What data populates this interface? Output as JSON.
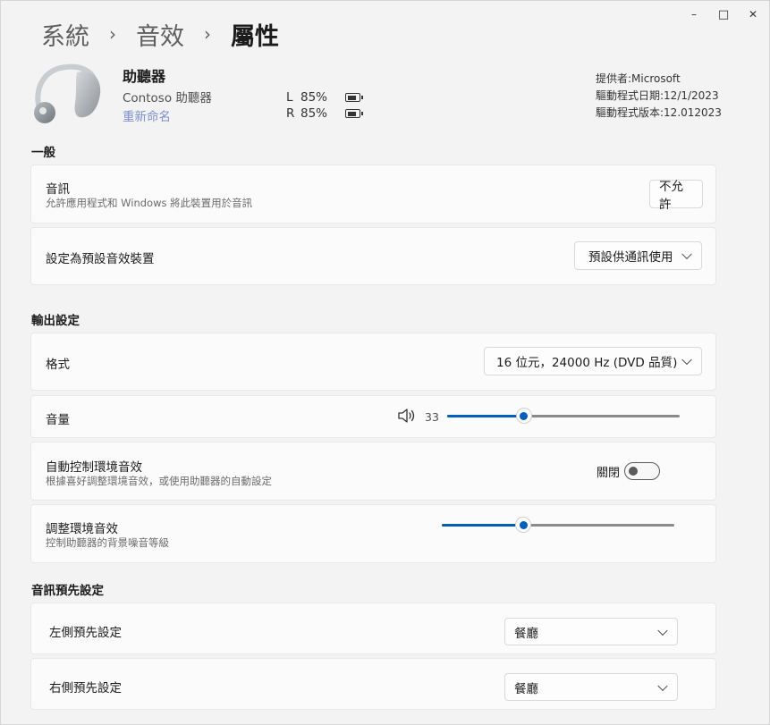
{
  "window": {
    "minimize": "–",
    "maximize": "□",
    "close": "✕"
  },
  "breadcrumb": {
    "items": [
      "系統",
      "音效"
    ],
    "separator": "›",
    "current": "屬性"
  },
  "device": {
    "name": "助聽器",
    "model": "Contoso 助聽器",
    "rename": "重新命名",
    "battery": [
      {
        "side": "L",
        "percent": "85%"
      },
      {
        "side": "R",
        "percent": "85%"
      }
    ],
    "provider": "提供者:Microsoft",
    "driver_date": "驅動程式日期:12/1/2023",
    "driver_version": "驅動程式版本:12.012023"
  },
  "general": {
    "title": "一般",
    "audio": {
      "title": "音訊",
      "subtitle": "允許應用程式和 Windows 將此裝置用於音訊",
      "button": "不允許"
    },
    "default_device": {
      "title": "設定為預設音效裝置",
      "value": "預設供通訊使用"
    }
  },
  "output": {
    "title": "輸出設定",
    "format": {
      "title": "格式",
      "value": "16 位元，24000 Hz (DVD 品質)"
    },
    "volume": {
      "title": "音量",
      "value": "33",
      "level": 0.33
    },
    "ambient_auto": {
      "title": "自動控制環境音效",
      "subtitle": "根據喜好調整環境音效，或使用助聽器的自動設定",
      "state": "關閉"
    },
    "ambient_adjust": {
      "title": "調整環境音效",
      "subtitle": "控制助聽器的背景噪音等級",
      "level": 0.35
    }
  },
  "presets": {
    "title": "音訊預先設定",
    "left": {
      "title": "左側預先設定",
      "value": "餐廳"
    },
    "right": {
      "title": "右側預先設定",
      "value": "餐廳"
    }
  },
  "colors": {
    "accent": "#005fb8",
    "link": "#7d8fd1"
  }
}
